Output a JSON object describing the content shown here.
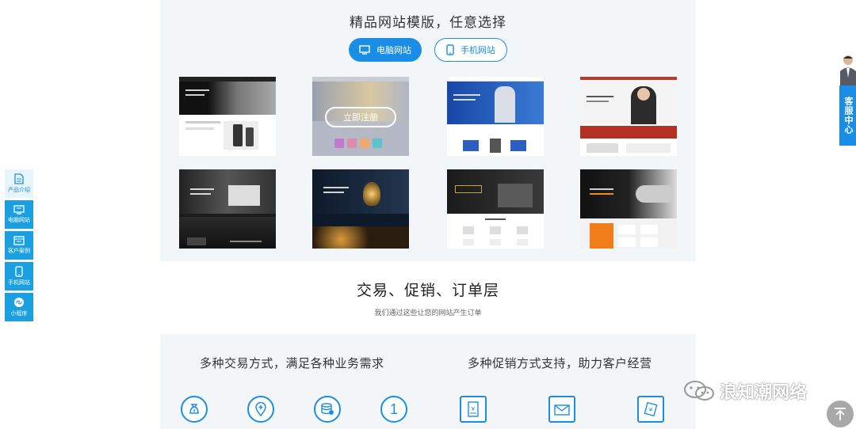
{
  "templates": {
    "title": "精品网站模版，任意选择",
    "tabs": [
      {
        "label": "电脑网站",
        "icon": "monitor-icon",
        "active": true
      },
      {
        "label": "手机网站",
        "icon": "phone-icon",
        "active": false
      }
    ],
    "overlay_button": "立即注册"
  },
  "trade": {
    "title": "交易、促销、订单层",
    "subtitle": "我们通过这些让您的网站产生订单",
    "left_heading": "多种交易方式，满足各种业务需求",
    "right_heading": "多种促销方式支持，助力客户经营",
    "left_icons": [
      "money-bag-icon",
      "location-pin-icon",
      "coin-stack-icon",
      "number-one-icon"
    ],
    "right_icons": [
      "coupon-icon",
      "envelope-icon",
      "voucher-icon"
    ]
  },
  "side_nav": {
    "items": [
      {
        "label": "产品介绍",
        "icon": "document-icon"
      },
      {
        "label": "电脑网站",
        "icon": "monitor-icon"
      },
      {
        "label": "客户案例",
        "icon": "case-icon"
      },
      {
        "label": "手机网站",
        "icon": "phone-icon"
      },
      {
        "label": "小程序",
        "icon": "mini-program-icon"
      }
    ]
  },
  "service": {
    "label": "客服中心"
  },
  "watermark": {
    "text": "浪知潮网络"
  },
  "colors": {
    "accent": "#1a8ee6",
    "panel": "#f3f6f9"
  }
}
